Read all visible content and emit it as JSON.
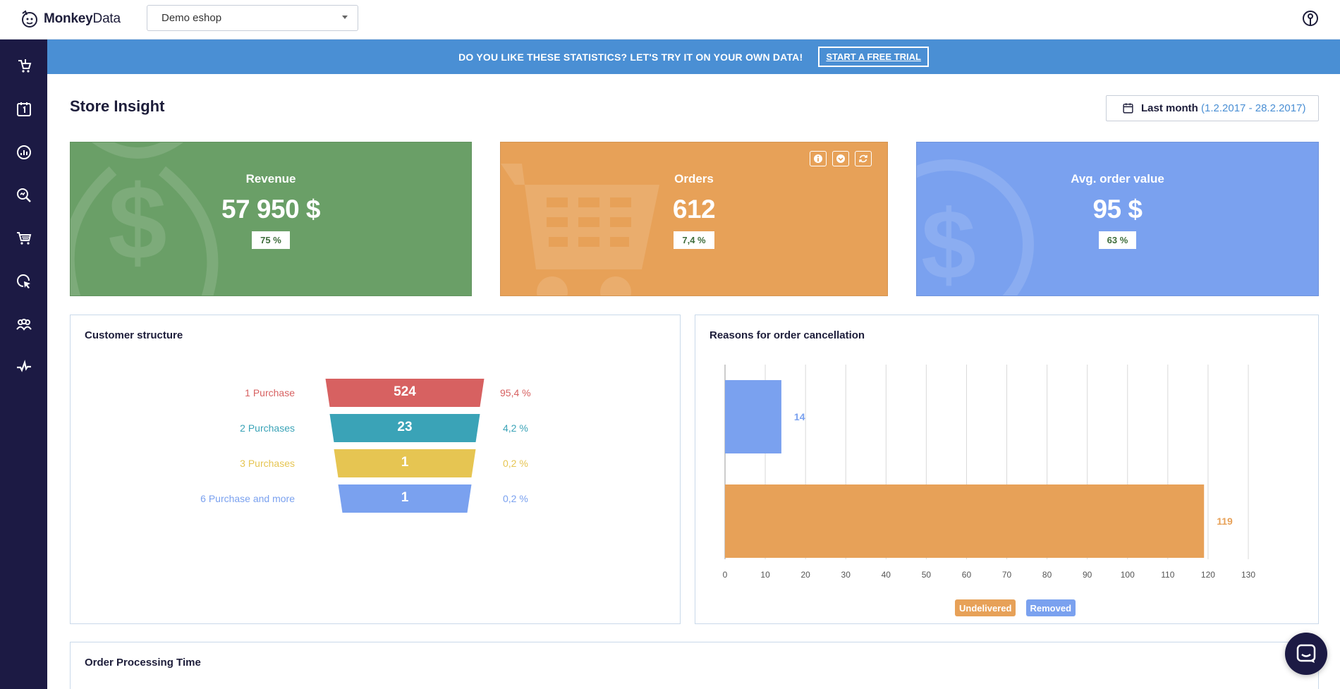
{
  "app": {
    "brand_bold": "Monkey",
    "brand_rest": "Data"
  },
  "shop_select": {
    "value": "Demo eshop"
  },
  "sidebar": {
    "items": [
      {
        "icon": "store-icon"
      },
      {
        "icon": "calendar-icon"
      },
      {
        "icon": "chart-icon"
      },
      {
        "icon": "analysis-search-icon"
      },
      {
        "icon": "cart-icon"
      },
      {
        "icon": "click-cursor-icon"
      },
      {
        "icon": "customers-icon"
      },
      {
        "icon": "pulse-icon"
      }
    ]
  },
  "banner": {
    "text": "DO YOU LIKE THESE STATISTICS? LET'S TRY IT ON YOUR OWN DATA!",
    "button": "START A FREE TRIAL"
  },
  "page": {
    "title": "Store Insight"
  },
  "date_range": {
    "label": "Last month",
    "range": "(1.2.2017 - 28.2.2017)"
  },
  "kpis": [
    {
      "label": "Revenue",
      "value": "57 950 $",
      "change": "75 %",
      "color": "#6a9f67"
    },
    {
      "label": "Orders",
      "value": "612",
      "change": "7,4 %",
      "color": "#e7a158"
    },
    {
      "label": "Avg. order value",
      "value": "95 $",
      "change": "63 %",
      "color": "#7aa1ef"
    }
  ],
  "customer_structure": {
    "title": "Customer structure",
    "rows": [
      {
        "label": "1 Purchase",
        "value": "524",
        "pct": "95,4 %",
        "color": "#d76161"
      },
      {
        "label": "2 Purchases",
        "value": "23",
        "pct": "4,2 %",
        "color": "#3aa3b7"
      },
      {
        "label": "3 Purchases",
        "value": "1",
        "pct": "0,2 %",
        "color": "#e6c552"
      },
      {
        "label": "6 Purchase and more",
        "value": "1",
        "pct": "0,2 %",
        "color": "#7aa1ef"
      }
    ]
  },
  "chart_data": {
    "type": "bar",
    "title": "Reasons for order cancellation",
    "orientation": "horizontal",
    "series": [
      {
        "name": "Removed",
        "values": [
          14
        ],
        "color": "#7aa1ef"
      },
      {
        "name": "Undelivered",
        "values": [
          119
        ],
        "color": "#e7a158"
      }
    ],
    "x_ticks": [
      "0",
      "10",
      "20",
      "30",
      "40",
      "50",
      "60",
      "70",
      "80",
      "90",
      "100",
      "110",
      "120",
      "130"
    ],
    "xlim": [
      0,
      130
    ],
    "grid": true,
    "legend": [
      "Undelivered",
      "Removed"
    ]
  },
  "order_processing": {
    "title": "Order Processing Time"
  }
}
